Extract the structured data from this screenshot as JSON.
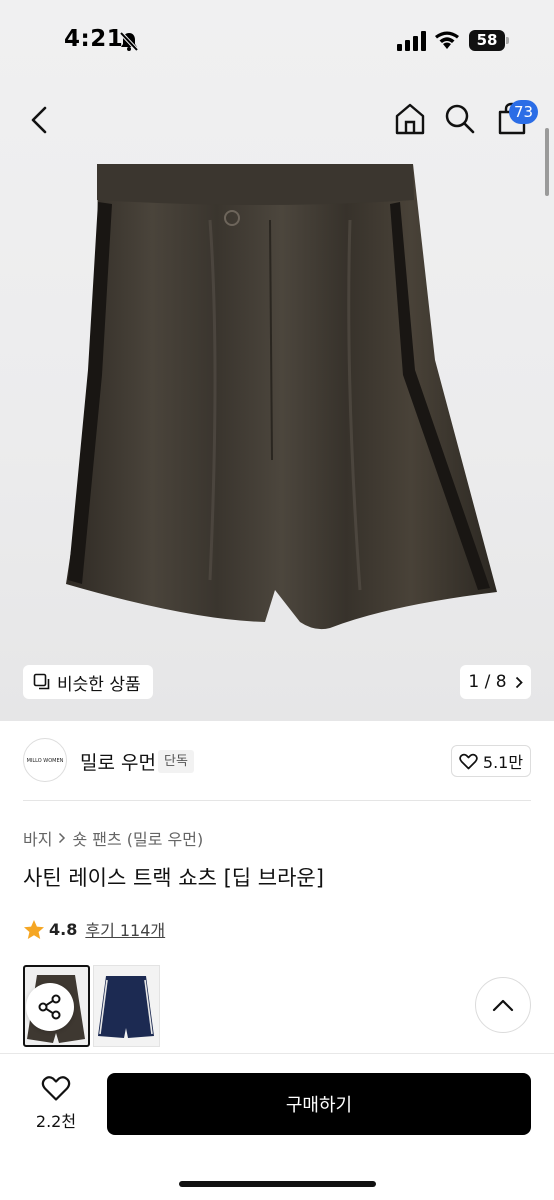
{
  "status_bar": {
    "time": "4:21",
    "battery": "58"
  },
  "nav": {
    "cart_count": "73"
  },
  "gallery": {
    "similar_label": "비슷한 상품",
    "pager": "1 / 8"
  },
  "brand": {
    "logo_text": "MILLO WOMEN",
    "name": "밀로 우먼",
    "tag": "단독",
    "likes": "5.1만"
  },
  "product": {
    "breadcrumb": [
      "바지",
      "숏 팬츠 (밀로 우먼)"
    ],
    "title": "사틴 레이스 트랙 쇼츠 [딥 브라운]",
    "rating": "4.8",
    "reviews": "후기 114개"
  },
  "bottom": {
    "wish_count": "2.2천",
    "buy_label": "구매하기"
  },
  "colors": {
    "accent": "#2b6de6",
    "star": "#f5a623",
    "primary_button": "#000000"
  },
  "icons": [
    "bell-off-icon",
    "signal-icon",
    "wifi-icon",
    "back-icon",
    "home-icon",
    "search-icon",
    "cart-icon",
    "copy-icon",
    "chevron-right-icon",
    "heart-icon",
    "star-icon",
    "share-icon",
    "chevron-up-icon"
  ]
}
